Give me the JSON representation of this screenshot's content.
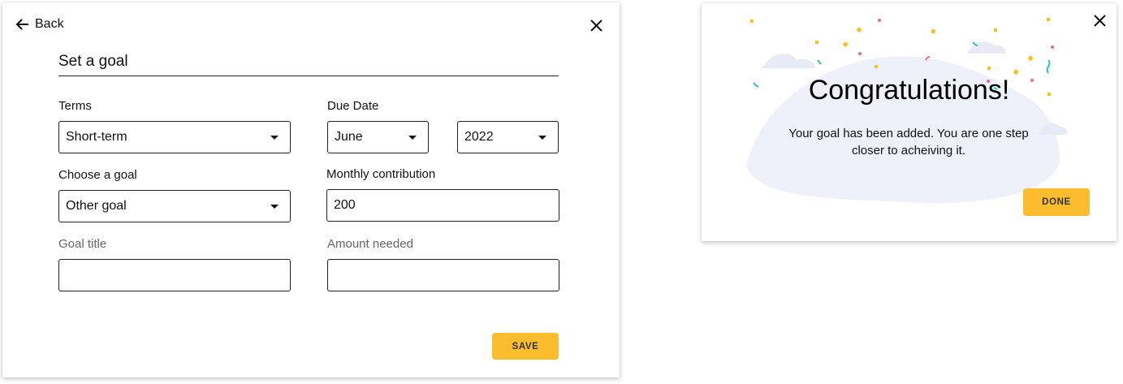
{
  "form": {
    "back_label": "Back",
    "title": "Set a goal",
    "terms": {
      "label": "Terms",
      "value": "Short-term"
    },
    "due_date": {
      "label": "Due Date",
      "month": "June",
      "year": "2022"
    },
    "choose_goal": {
      "label": "Choose a goal",
      "value": "Other goal"
    },
    "monthly_contribution": {
      "label": "Monthly contribution",
      "value": "200"
    },
    "goal_title": {
      "label": "Goal title",
      "value": ""
    },
    "amount_needed": {
      "label": "Amount needed",
      "value": ""
    },
    "save_label": "SAVE"
  },
  "modal": {
    "title": "Congratulations!",
    "message": "Your goal has been added. You are one step closer to acheiving it.",
    "done_label": "DONE"
  },
  "colors": {
    "accent": "#fbbc2e",
    "border": "#222222"
  },
  "icons": {
    "back": "arrow-left-icon",
    "close": "close-icon",
    "dropdown": "caret-down-icon"
  }
}
